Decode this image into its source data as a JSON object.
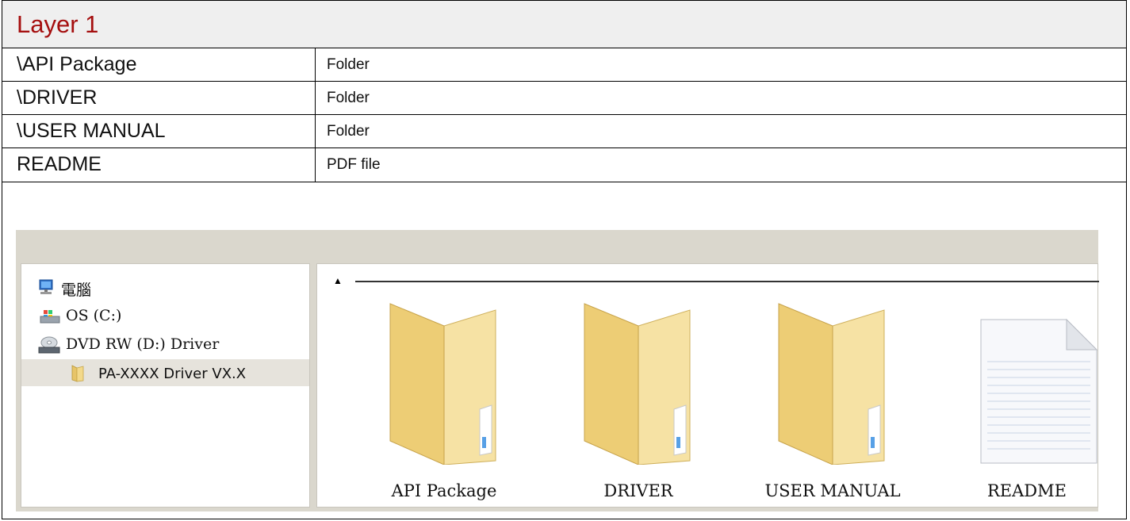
{
  "title": "Layer 1",
  "rows": [
    {
      "name": "\\API Package",
      "desc": "Folder"
    },
    {
      "name": "\\DRIVER",
      "desc": "Folder"
    },
    {
      "name": "\\USER MANUAL",
      "desc": "Folder"
    },
    {
      "name": "README",
      "desc": "PDF file"
    }
  ],
  "explorer": {
    "nav": [
      {
        "label": "電腦",
        "icon": "computer-icon"
      },
      {
        "label": "OS (C:)",
        "icon": "windows-drive-icon"
      },
      {
        "label": "DVD RW (D:) Driver",
        "icon": "dvd-drive-icon"
      },
      {
        "label": "PA-XXXX Driver VX.X",
        "icon": "folder-icon",
        "selected": true
      }
    ],
    "items": [
      {
        "label": "API Package",
        "icon": "folder-icon"
      },
      {
        "label": "DRIVER",
        "icon": "folder-icon"
      },
      {
        "label": "USER MANUAL",
        "icon": "folder-icon"
      },
      {
        "label": "README",
        "icon": "document-icon"
      }
    ],
    "sort_icon": "sort-up-arrow-icon"
  },
  "colors": {
    "title": "#a50f0f",
    "title_bg": "#efefef",
    "explorer_bg": "#dad7cd",
    "folder": "#f3d98a"
  }
}
